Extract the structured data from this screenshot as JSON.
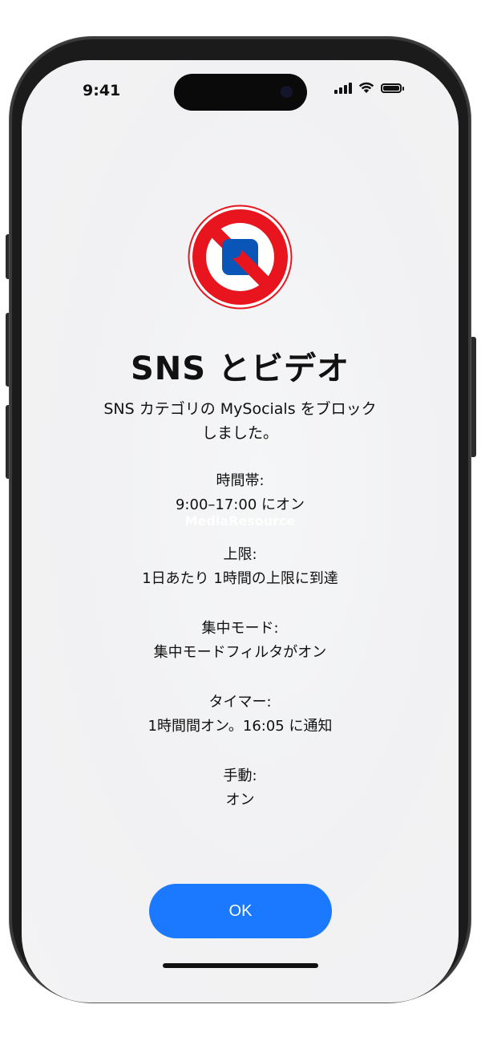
{
  "status_bar": {
    "time": "9:41",
    "icons": [
      "signal-icon",
      "wifi-icon",
      "battery-icon"
    ]
  },
  "app_icon": {
    "name": "blocked-app-icon",
    "colors": {
      "ring": "#e8141e",
      "square": "#0a56b8",
      "fill": "#ffffff"
    }
  },
  "title": "SNS とビデオ",
  "message": {
    "line1": "SNS カテゴリの MySocials をブロック",
    "line2": "しました。"
  },
  "details": [
    {
      "label": "時間帯:",
      "value": "9:00–17:00 にオン"
    },
    {
      "label": "上限:",
      "value": "1日あたり 1時間の上限に到達"
    },
    {
      "label": "集中モード:",
      "value": "集中モードフィルタがオン"
    },
    {
      "label": "タイマー:",
      "value": "1時間間オン。16:05 に通知"
    },
    {
      "label": "手動:",
      "value": "オン"
    }
  ],
  "watermark": "MediaResource",
  "ok_button": "OK",
  "colors": {
    "accent": "#1a79ff"
  }
}
